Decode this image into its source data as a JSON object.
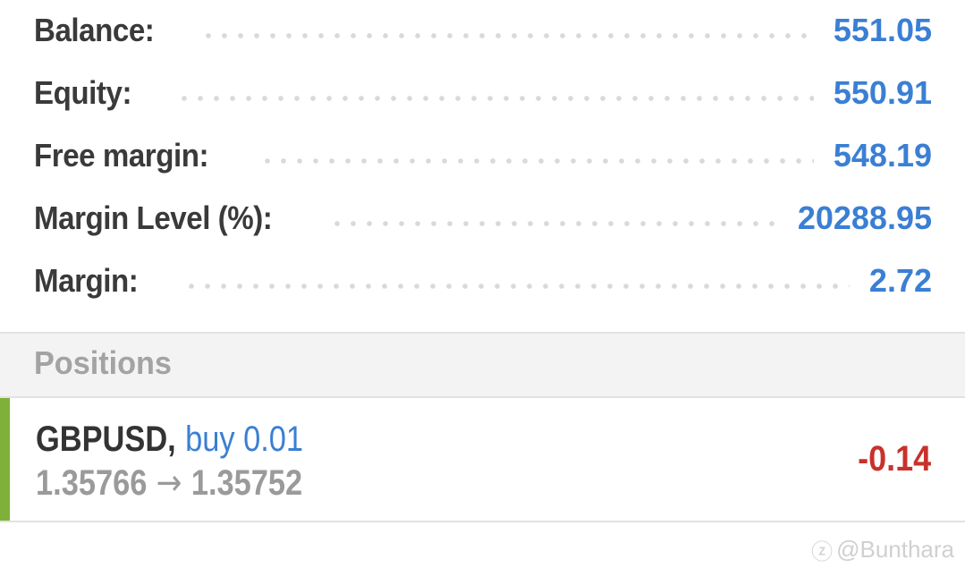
{
  "account_summary": [
    {
      "label": "Balance:",
      "value": "551.05"
    },
    {
      "label": "Equity:",
      "value": "550.91"
    },
    {
      "label": "Free margin:",
      "value": "548.19"
    },
    {
      "label": "Margin Level (%):",
      "value": "20288.95"
    },
    {
      "label": "Margin:",
      "value": "2.72"
    }
  ],
  "positions_section": {
    "title": "Positions"
  },
  "positions": [
    {
      "symbol": "GBPUSD",
      "comma": ",",
      "trade": "buy 0.01",
      "open_price": "1.35766",
      "arrow": "→",
      "current_price": "1.35752",
      "profit": "-0.14"
    }
  ],
  "watermark": {
    "icon": "zhihu-icon",
    "icon_glyph": "ⓩ",
    "text": "@Bunthara"
  },
  "colors": {
    "value_blue": "#3a7fd4",
    "loss_red": "#c8322b",
    "buy_accent_green": "#7fb13a",
    "label_dark": "#3a3a3a",
    "header_gray": "#a3a3a3"
  }
}
